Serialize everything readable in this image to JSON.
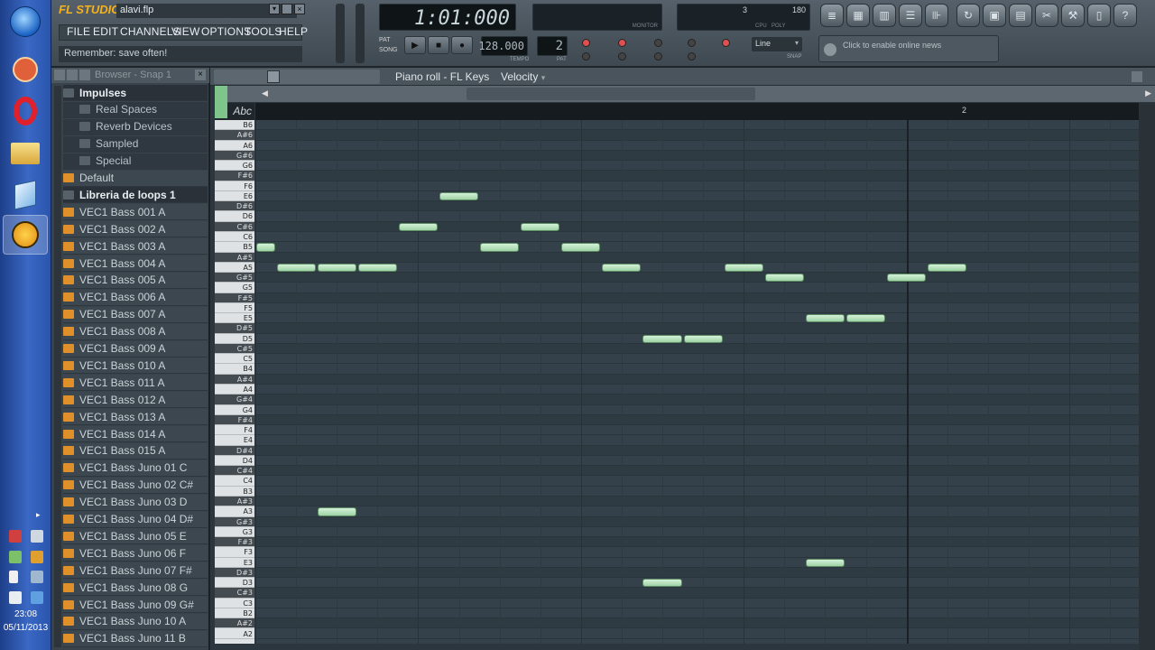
{
  "title": {
    "app": "FL STUDIO",
    "file": "alavi.flp"
  },
  "menu": [
    "FILE",
    "EDIT",
    "CHANNELS",
    "VIEW",
    "OPTIONS",
    "TOOLS",
    "HELP"
  ],
  "hint": "Remember: save often!",
  "transport": {
    "time": "1:01:000",
    "tempo": "128.000",
    "pattern": "2",
    "snap": "Line",
    "tempo_label": "TEMPO",
    "pat_label": "PAT",
    "snap_label": "SNAP",
    "pat_song": [
      "PAT",
      "SONG"
    ]
  },
  "meters": {
    "cpu_label": "CPU",
    "poly_label": "POLY",
    "poly_max": "180",
    "cpu_value": "3",
    "monitor_label": "MONITOR"
  },
  "news": "Click to enable online news",
  "browser": {
    "title": "Browser - Snap 1",
    "items": [
      {
        "label": "Impulses",
        "kind": "special"
      },
      {
        "label": "Real Spaces",
        "kind": "folder"
      },
      {
        "label": "Reverb Devices",
        "kind": "folder"
      },
      {
        "label": "Sampled",
        "kind": "folder"
      },
      {
        "label": "Special",
        "kind": "folder"
      },
      {
        "label": "Default",
        "kind": "file"
      },
      {
        "label": "Libreria de loops 1",
        "kind": "special"
      },
      {
        "label": "VEC1 Bass 001 A",
        "kind": "file"
      },
      {
        "label": "VEC1 Bass 002 A",
        "kind": "file"
      },
      {
        "label": "VEC1 Bass 003 A",
        "kind": "file"
      },
      {
        "label": "VEC1 Bass 004 A",
        "kind": "file"
      },
      {
        "label": "VEC1 Bass 005 A",
        "kind": "file"
      },
      {
        "label": "VEC1 Bass 006 A",
        "kind": "file"
      },
      {
        "label": "VEC1 Bass 007 A",
        "kind": "file"
      },
      {
        "label": "VEC1 Bass 008 A",
        "kind": "file"
      },
      {
        "label": "VEC1 Bass 009 A",
        "kind": "file"
      },
      {
        "label": "VEC1 Bass 010 A",
        "kind": "file"
      },
      {
        "label": "VEC1 Bass 011 A",
        "kind": "file"
      },
      {
        "label": "VEC1 Bass 012 A",
        "kind": "file"
      },
      {
        "label": "VEC1 Bass 013 A",
        "kind": "file"
      },
      {
        "label": "VEC1 Bass 014 A",
        "kind": "file"
      },
      {
        "label": "VEC1 Bass 015 A",
        "kind": "file"
      },
      {
        "label": "VEC1 Bass Juno 01 C",
        "kind": "file"
      },
      {
        "label": "VEC1 Bass Juno 02 C#",
        "kind": "file"
      },
      {
        "label": "VEC1 Bass Juno 03 D",
        "kind": "file"
      },
      {
        "label": "VEC1 Bass Juno 04 D#",
        "kind": "file"
      },
      {
        "label": "VEC1 Bass Juno 05 E",
        "kind": "file"
      },
      {
        "label": "VEC1 Bass Juno 06 F",
        "kind": "file"
      },
      {
        "label": "VEC1 Bass Juno 07 F#",
        "kind": "file"
      },
      {
        "label": "VEC1 Bass Juno 08 G",
        "kind": "file"
      },
      {
        "label": "VEC1 Bass Juno 09 G#",
        "kind": "file"
      },
      {
        "label": "VEC1 Bass Juno 10 A",
        "kind": "file"
      },
      {
        "label": "VEC1 Bass Juno 11 B",
        "kind": "file"
      }
    ]
  },
  "pianoroll": {
    "title": "Piano roll - FL Keys",
    "target": "Velocity",
    "event_lane_label": "Abc",
    "bar_marker": "2",
    "keys": [
      "B6",
      "A#6",
      "A6",
      "G#6",
      "G6",
      "F#6",
      "F6",
      "E6",
      "D#6",
      "D6",
      "C#6",
      "C6",
      "B5",
      "A#5",
      "A5",
      "G#5",
      "G5",
      "F#5",
      "F5",
      "E5",
      "D#5",
      "D5",
      "C#5",
      "C5",
      "B4",
      "A#4",
      "A4",
      "G#4",
      "G4",
      "F#4",
      "F4",
      "E4",
      "D#4",
      "D4",
      "C#4",
      "C4",
      "B3",
      "A#3",
      "A3",
      "G#3",
      "G3",
      "F#3",
      "F3",
      "E3",
      "D#3",
      "D3",
      "C#3",
      "C3",
      "B2",
      "A#2",
      "A2"
    ],
    "notes": [
      {
        "pitch": "B5",
        "step": 0,
        "len": 0.5
      },
      {
        "pitch": "A5",
        "step": 0.5,
        "len": 1
      },
      {
        "pitch": "A5",
        "step": 1.5,
        "len": 1
      },
      {
        "pitch": "A5",
        "step": 2.5,
        "len": 1
      },
      {
        "pitch": "C#6",
        "step": 3.5,
        "len": 1
      },
      {
        "pitch": "E6",
        "step": 4.5,
        "len": 1
      },
      {
        "pitch": "B5",
        "step": 5.5,
        "len": 1
      },
      {
        "pitch": "C#6",
        "step": 6.5,
        "len": 1
      },
      {
        "pitch": "B5",
        "step": 7.5,
        "len": 1
      },
      {
        "pitch": "A5",
        "step": 8.5,
        "len": 1
      },
      {
        "pitch": "D5",
        "step": 9.5,
        "len": 1
      },
      {
        "pitch": "D5",
        "step": 10.5,
        "len": 1
      },
      {
        "pitch": "A5",
        "step": 11.5,
        "len": 1
      },
      {
        "pitch": "G#5",
        "step": 12.5,
        "len": 1
      },
      {
        "pitch": "E5",
        "step": 13.5,
        "len": 1
      },
      {
        "pitch": "E5",
        "step": 14.5,
        "len": 1
      },
      {
        "pitch": "G#5",
        "step": 15.5,
        "len": 1
      },
      {
        "pitch": "A5",
        "step": 16.5,
        "len": 1
      },
      {
        "pitch": "A3",
        "step": 1.5,
        "len": 1
      },
      {
        "pitch": "D3",
        "step": 9.5,
        "len": 1
      },
      {
        "pitch": "E3",
        "step": 13.5,
        "len": 1
      }
    ]
  },
  "taskbar": {
    "time": "23:08",
    "date": "05/11/2013"
  },
  "colors": {
    "note": "#b4e0bb",
    "grid": "#34414a",
    "panel": "#3d474f",
    "accent": "#f0a020"
  }
}
